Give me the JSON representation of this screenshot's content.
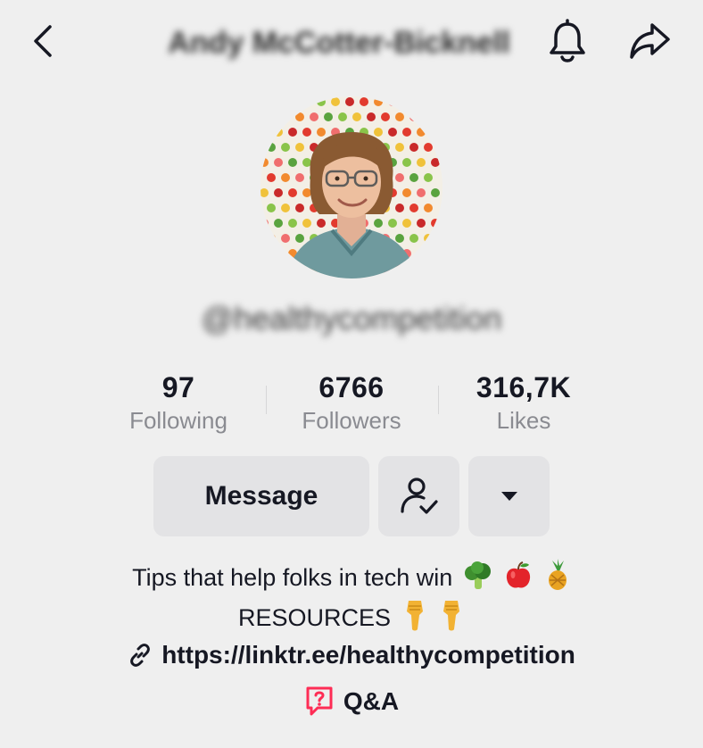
{
  "header": {
    "display_name": "Andy McCotter-Bicknell",
    "back_icon": "chevron-left-icon",
    "bell_icon": "bell-icon",
    "share_icon": "share-icon"
  },
  "profile": {
    "username": "@healthycompetition",
    "avatar_icon": "profile-photo"
  },
  "stats": [
    {
      "value": "97",
      "label": "Following"
    },
    {
      "value": "6766",
      "label": "Followers"
    },
    {
      "value": "316,7K",
      "label": "Likes"
    }
  ],
  "actions": {
    "message_label": "Message",
    "following_icon": "user-check-icon",
    "more_icon": "caret-down-icon"
  },
  "bio": {
    "line1": "Tips that help folks in tech win",
    "line1_emojis": [
      "broccoli",
      "apple",
      "pineapple"
    ],
    "line2": "RESOURCES",
    "line2_emojis": [
      "pointing-down",
      "pointing-down"
    ]
  },
  "link": {
    "url": "https://linktr.ee/healthycompetition",
    "icon": "link-icon"
  },
  "qa": {
    "label": "Q&A",
    "icon": "question-box-icon",
    "color": "#fe2c55"
  }
}
